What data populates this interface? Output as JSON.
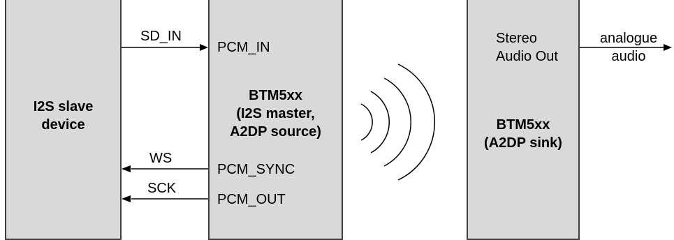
{
  "colors": {
    "box_fill": "#d9d9d9",
    "box_border": "#404040",
    "line": "#000000",
    "background": "#ffffff"
  },
  "blocks": {
    "slave": {
      "line1": "I2S slave",
      "line2": "device"
    },
    "master": {
      "title_line1": "BTM5xx",
      "title_line2": "(I2S master,",
      "title_line3": "A2DP source)",
      "pin_pcm_in": "PCM_IN",
      "pin_pcm_sync": "PCM_SYNC",
      "pin_pcm_out": "PCM_OUT"
    },
    "sink": {
      "out_line1": "Stereo",
      "out_line2": "Audio Out",
      "title_line1": "BTM5xx",
      "title_line2": "(A2DP sink)"
    }
  },
  "signals": {
    "sd_in": "SD_IN",
    "ws": "WS",
    "sck": "SCK",
    "analogue_line1": "analogue",
    "analogue_line2": "audio"
  },
  "wireless_icon": "radio-waves-icon"
}
